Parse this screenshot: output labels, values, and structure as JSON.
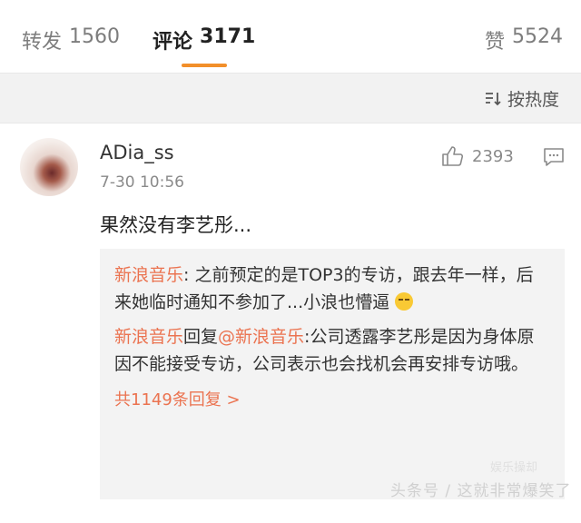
{
  "tabs": {
    "repost": {
      "label": "转发",
      "count": "1560"
    },
    "comment": {
      "label": "评论",
      "count": "3171"
    },
    "like": {
      "label": "赞",
      "count": "5524"
    }
  },
  "sort": {
    "label": "按热度",
    "icon": "sort-icon"
  },
  "comment": {
    "username": "ADia_ss",
    "timestamp": "7-30 10:56",
    "likes": "2393",
    "text": "果然没有李艺彤...",
    "replies": [
      {
        "author": "新浪音乐",
        "separator": ": ",
        "text": "之前预定的是TOP3的专访，跟去年一样，后来她临时通知不参加了...小浪也懵逼"
      },
      {
        "author": "新浪音乐",
        "mid": "回复",
        "target": "@新浪音乐",
        "separator": ":",
        "text": "公司透露李艺彤是因为身体原因不能接受专访，公司表示也会找机会再安排专访哦。"
      }
    ],
    "more_replies": "共1149条回复 >"
  },
  "watermark": {
    "main": "头条号 / 这就非常爆笑了",
    "small": "娱乐操却"
  }
}
